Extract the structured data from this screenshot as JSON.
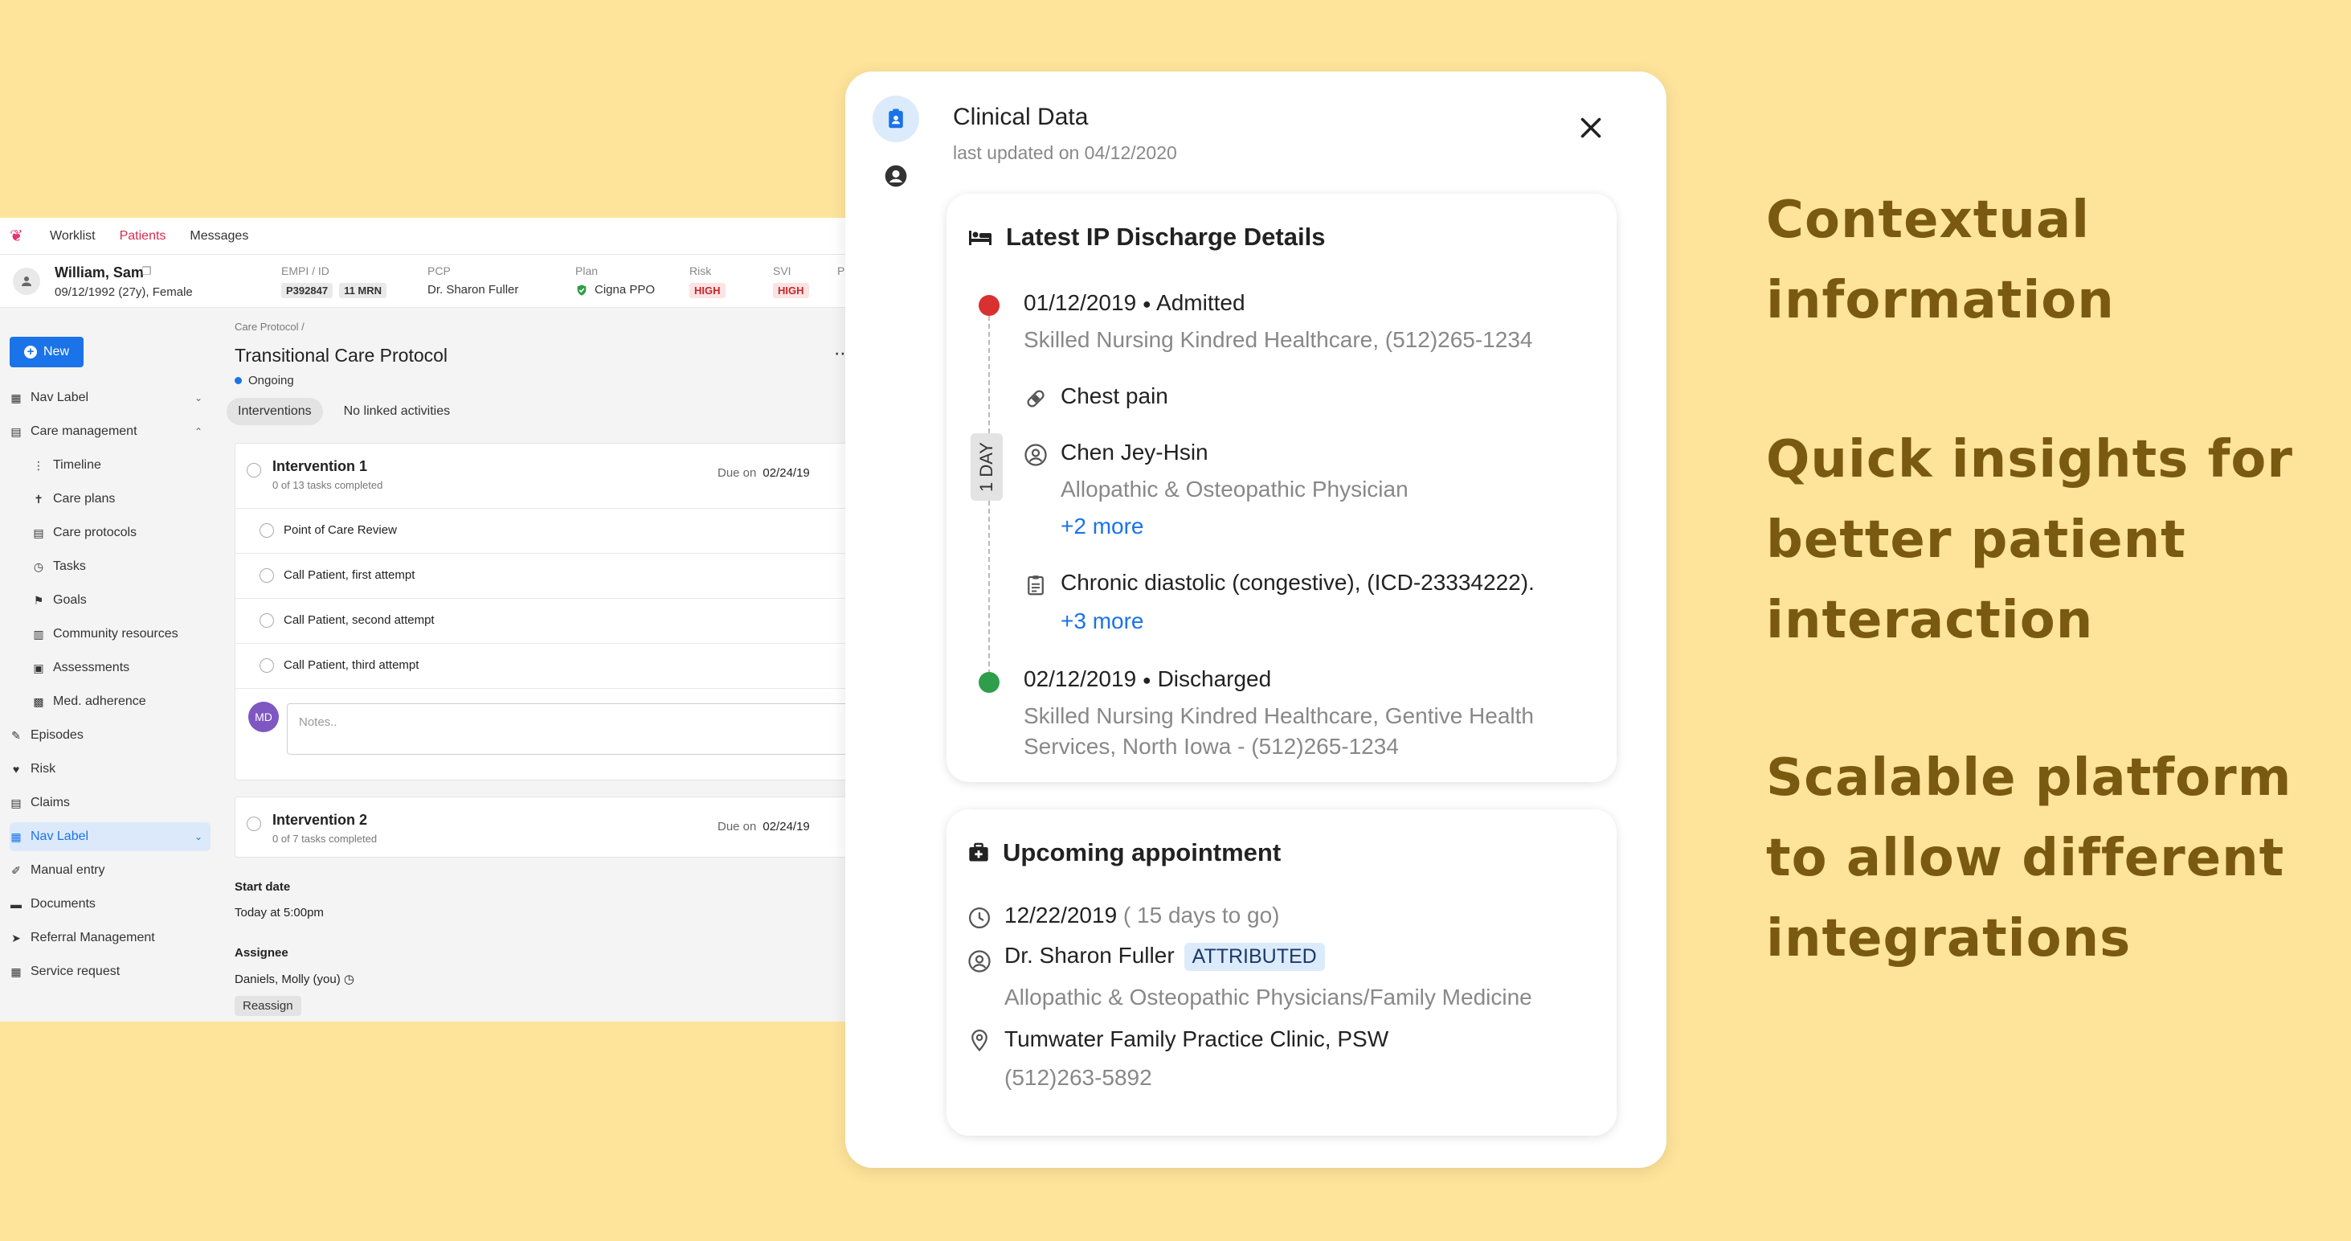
{
  "app": {
    "nav": [
      "Worklist",
      "Patients",
      "Messages"
    ],
    "patient": {
      "name": "William, Sam",
      "copy_glyph": "❐",
      "dob": "09/12/1992 (27y), Female",
      "empi_label": "EMPI / ID",
      "empi_id": "P392847",
      "mrn": "11 MRN",
      "pcp_label": "PCP",
      "pcp": "Dr. Sharon Fuller",
      "plan_label": "Plan",
      "plan": "Cigna PPO",
      "risk_label": "Risk",
      "risk": "HIGH",
      "svi_label": "SVI",
      "svi": "HIGH",
      "extra_label": "P"
    },
    "sidebar": {
      "new_label": "New",
      "items": [
        {
          "label": "Nav Label",
          "icon": "calendar-icon"
        },
        {
          "label": "Care management",
          "icon": "inbox-icon"
        },
        {
          "label": "Timeline",
          "icon": "timeline-icon"
        },
        {
          "label": "Care plans",
          "icon": "person-icon"
        },
        {
          "label": "Care protocols",
          "icon": "list-icon"
        },
        {
          "label": "Tasks",
          "icon": "alarm-icon"
        },
        {
          "label": "Goals",
          "icon": "flag-icon"
        },
        {
          "label": "Community resources",
          "icon": "building-icon"
        },
        {
          "label": "Assessments",
          "icon": "clipboard-icon"
        },
        {
          "label": "Med. adherence",
          "icon": "pill-icon"
        },
        {
          "label": "Episodes",
          "icon": "episodes-icon"
        },
        {
          "label": "Risk",
          "icon": "heart-icon"
        },
        {
          "label": "Claims",
          "icon": "claims-icon"
        },
        {
          "label": "Nav Label",
          "icon": "calendar-icon"
        },
        {
          "label": "Manual entry",
          "icon": "edit-icon"
        },
        {
          "label": "Documents",
          "icon": "folder-icon"
        },
        {
          "label": "Referral Management",
          "icon": "send-icon"
        },
        {
          "label": "Service request",
          "icon": "grid-icon"
        }
      ]
    },
    "main": {
      "breadcrumb": "Care Protocol /",
      "title": "Transitional Care Protocol",
      "status": "Ongoing",
      "tabs": [
        "Interventions",
        "No linked activities"
      ],
      "interventions": [
        {
          "title": "Intervention 1",
          "sub": "0 of 13 tasks completed",
          "due_label": "Due on",
          "due": "02/24/19"
        },
        {
          "title": "Intervention 2",
          "sub": "0 of 7 tasks completed",
          "due_label": "Due on",
          "due": "02/24/19"
        }
      ],
      "tasks": [
        "Point of Care Review",
        "Call Patient, first attempt",
        "Call Patient, second attempt",
        "Call Patient, third attempt"
      ],
      "avatar_initials": "MD",
      "notes_placeholder": "Notes..",
      "start_date_label": "Start date",
      "start_date": "Today at 5:00pm",
      "assignee_label": "Assignee",
      "assignee": "Daniels, Molly (you)",
      "reassign": "Reassign"
    }
  },
  "modal": {
    "title": "Clinical Data",
    "subtitle": "last updated on 04/12/2020",
    "discharge": {
      "heading": "Latest IP Discharge Details",
      "admitted_date": "01/12/2019",
      "admitted_label": "Admitted",
      "admitted_facility": "Skilled Nursing Kindred Healthcare, (512)265-1234",
      "complaint": "Chest pain",
      "day_badge": "1 DAY",
      "physician": "Chen Jey-Hsin",
      "physician_specialty": "Allopathic & Osteopathic Physician",
      "physician_more": "+2 more",
      "diagnosis": "Chronic diastolic (congestive), (ICD-23334222).",
      "diagnosis_more": "+3 more",
      "discharged_date": "02/12/2019",
      "discharged_label": "Discharged",
      "discharged_facility_1": "Skilled Nursing Kindred Healthcare, Gentive Health",
      "discharged_facility_2": "Services, North Iowa - (512)265-1234"
    },
    "appointment": {
      "heading": "Upcoming appointment",
      "date": "12/22/2019",
      "countdown": "( 15 days  to go)",
      "doctor": "Dr. Sharon Fuller",
      "badge": "ATTRIBUTED",
      "specialty": "Allopathic & Osteopathic Physicians/Family Medicine",
      "location": "Tumwater Family Practice Clinic, PSW",
      "phone": "(512)263-5892"
    }
  },
  "headlines": [
    [
      "Contextual",
      "information"
    ],
    [
      "Quick insights for",
      "better patient",
      "interaction"
    ],
    [
      "Scalable platform",
      "to allow different",
      "integrations"
    ]
  ],
  "colors": {
    "background": "#FEE49A",
    "headline": "#7A5A10",
    "accent": "#1A73E8",
    "admitted": "#D93030",
    "discharged": "#2E9E4A"
  }
}
